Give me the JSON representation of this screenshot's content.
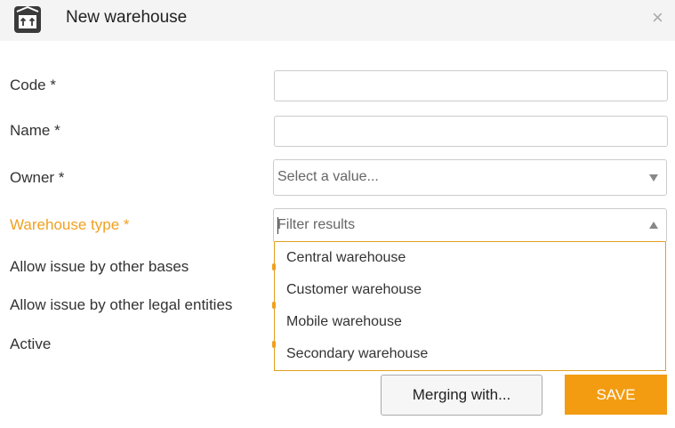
{
  "window": {
    "title": "New warehouse",
    "close_glyph": "×",
    "icon": "warehouse-box-icon"
  },
  "form": {
    "fields": [
      {
        "label": "Code *",
        "value": ""
      },
      {
        "label": "Name *",
        "value": ""
      },
      {
        "label": "Owner *",
        "placeholder": "Select a value..."
      },
      {
        "label": "Warehouse type *",
        "filter_placeholder": "Filter results"
      },
      {
        "label": "Allow issue by other bases"
      },
      {
        "label": "Allow issue by other legal entities"
      },
      {
        "label": "Active"
      }
    ],
    "warehouse_type_options": [
      "Central warehouse",
      "Customer warehouse",
      "Mobile warehouse",
      "Secondary warehouse"
    ]
  },
  "actions": {
    "merge_label": "Merging with...",
    "save_label": "SAVE"
  },
  "colors": {
    "accent": "#f39c12",
    "focus_label": "#f0a020",
    "titlebar_bg": "#f4f4f4"
  }
}
